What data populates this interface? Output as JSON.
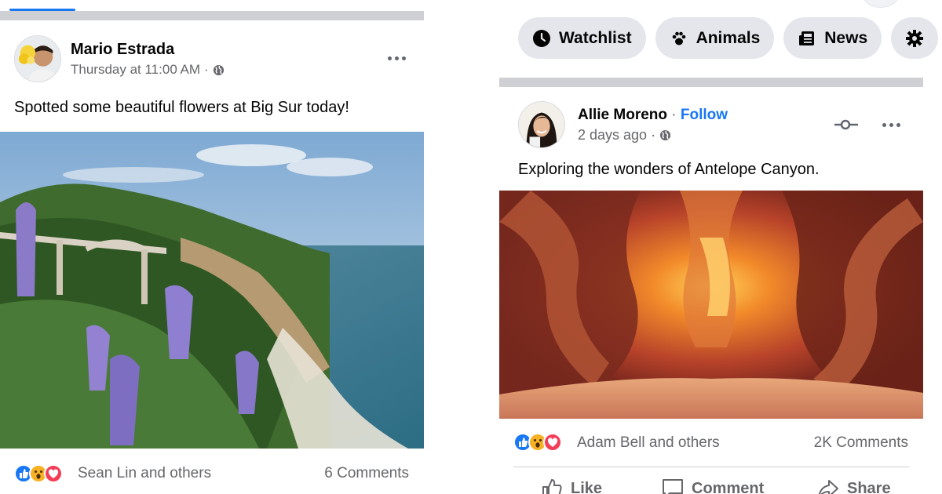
{
  "left_post": {
    "author": "Mario Estrada",
    "timestamp": "Thursday at 11:00 AM",
    "separator": "·",
    "privacy_icon": "globe-icon",
    "caption": "Spotted some beautiful flowers at Big Sur today!",
    "reactions": [
      "like-icon",
      "wow-icon",
      "love-icon"
    ],
    "reaction_text": "Sean Lin and others",
    "comments": "6 Comments"
  },
  "nav_chips": [
    {
      "label": "Watchlist",
      "icon": "clock-icon"
    },
    {
      "label": "Animals",
      "icon": "paw-icon"
    },
    {
      "label": "News",
      "icon": "newspaper-icon"
    },
    {
      "label": "",
      "icon": "gear-icon"
    }
  ],
  "right_post": {
    "author": "Allie Moreno",
    "name_separator": "·",
    "follow_label": "Follow",
    "timestamp": "2 days ago",
    "separator": "·",
    "privacy_icon": "globe-icon",
    "caption": "Exploring the wonders of Antelope Canyon.",
    "reactions": [
      "like-icon",
      "wow-icon",
      "love-icon"
    ],
    "reaction_text": "Adam Bell and others",
    "comments": "2K Comments",
    "actions": {
      "like": "Like",
      "comment": "Comment",
      "share": "Share"
    }
  },
  "colors": {
    "accent": "#1877f2",
    "secondary_text": "#65676b",
    "separator": "#ced0d4",
    "chip_bg": "#e4e6eb",
    "love": "#f33e58",
    "wow": "#f7b125"
  }
}
